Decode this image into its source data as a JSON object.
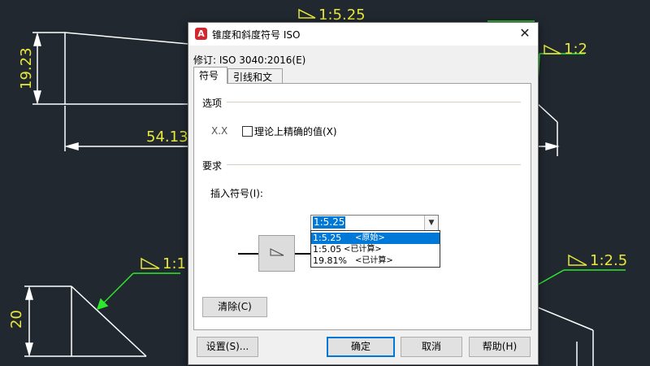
{
  "cad": {
    "labels": {
      "ratio_top": "1:5.25",
      "ratio_right": "1:2",
      "dim_vertical": "19.23",
      "dim_horizontal": "54.13",
      "ratio_left": "1:1",
      "ratio_right_bottom": "1:2.5",
      "dim_bottom": "20"
    },
    "colors": {
      "background": "#212830",
      "annotation": "#e8e83a",
      "leader": "#2ee82e",
      "geometry": "#ffffff"
    }
  },
  "dialog": {
    "title": "锥度和斜度符号 ISO",
    "app_icon_letter": "A",
    "close_label": "✕",
    "revision": "修订: ISO 3040:2016(E)",
    "tabs": [
      {
        "label": "符号"
      },
      {
        "label": "引线和文字"
      }
    ],
    "options": {
      "title": "选项",
      "xx": "X.X",
      "theoretical_label": "理论上精确的值(X)",
      "theoretical_checked": false
    },
    "requirements": {
      "title": "要求",
      "insert_label": "插入符号(I):",
      "combo_value": "1:5.25",
      "options": [
        {
          "value": "1:5.25",
          "tag": "<原始>",
          "selected": true
        },
        {
          "value": "1:5.05",
          "tag": "<已计算>",
          "selected": false
        },
        {
          "value": "19.81%",
          "tag": "<已计算>",
          "selected": false
        }
      ]
    },
    "clear_label": "清除(C)",
    "buttons": {
      "settings": "设置(S)...",
      "ok": "确定",
      "cancel": "取消",
      "help": "帮助(H)"
    },
    "accent": "#0078d7"
  }
}
